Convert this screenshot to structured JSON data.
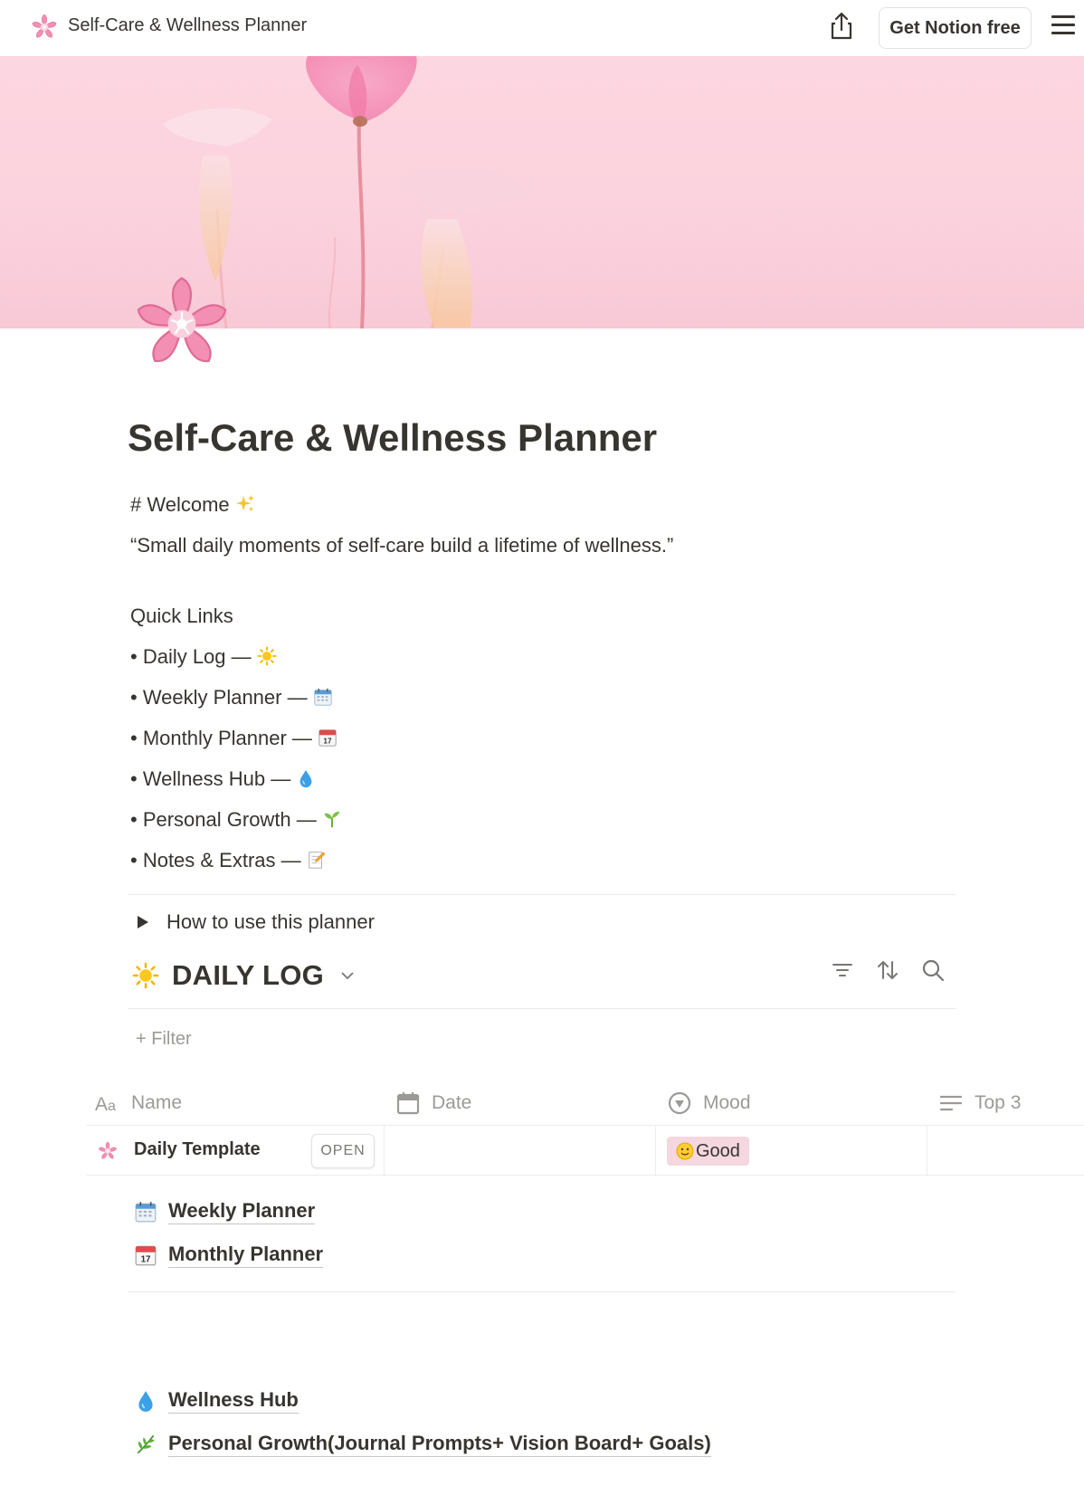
{
  "topbar": {
    "title": "Self-Care & Wellness Planner",
    "page_icon": "cherry-blossom-icon",
    "share_icon": "share-icon",
    "get_notion_label": "Get Notion free",
    "menu_icon": "hamburger-menu-icon"
  },
  "page": {
    "title": "Self-Care & Wellness Planner",
    "icon": "cherry-blossom-icon",
    "welcome": "# Welcome",
    "quote": "“Small daily moments of self-care build a lifetime of wellness.”",
    "quick_links_heading": "Quick Links",
    "quick_links": [
      {
        "label": "• Daily Log —",
        "icon": "sun-icon"
      },
      {
        "label": "• Weekly Planner —",
        "icon": "calendar-icon"
      },
      {
        "label": "• Monthly Planner —",
        "icon": "date-calendar-icon"
      },
      {
        "label": "• Wellness Hub —",
        "icon": "droplet-icon"
      },
      {
        "label": "• Personal Growth —",
        "icon": "seedling-icon"
      },
      {
        "label": "• Notes & Extras —",
        "icon": "memo-icon"
      }
    ],
    "toggle_label": "How to use this planner"
  },
  "database": {
    "title": "DAILY LOG",
    "filter_label": "+ Filter",
    "columns": [
      {
        "label": "Name",
        "icon": "text-aa-icon"
      },
      {
        "label": "Date",
        "icon": "calendar-icon"
      },
      {
        "label": "Mood",
        "icon": "status-icon"
      },
      {
        "label": "Top 3",
        "icon": "lines-icon"
      }
    ],
    "rows": [
      {
        "name": "Daily Template",
        "open_label": "OPEN",
        "date": "",
        "mood": "Good",
        "top3": ""
      }
    ]
  },
  "links": [
    {
      "label": "Weekly Planner",
      "icon": "calendar-icon"
    },
    {
      "label": "Monthly Planner",
      "icon": "date-calendar-icon"
    },
    {
      "label": "Wellness Hub",
      "icon": "droplet-icon"
    },
    {
      "label": "Personal Growth(Journal Prompts+ Vision Board+ Goals)",
      "icon": "herb-icon"
    }
  ],
  "colors": {
    "text": "#37352f",
    "muted": "#9b9a97",
    "cover_pink": "#fcd6e0",
    "mood_tag": "#f5d7e0"
  }
}
